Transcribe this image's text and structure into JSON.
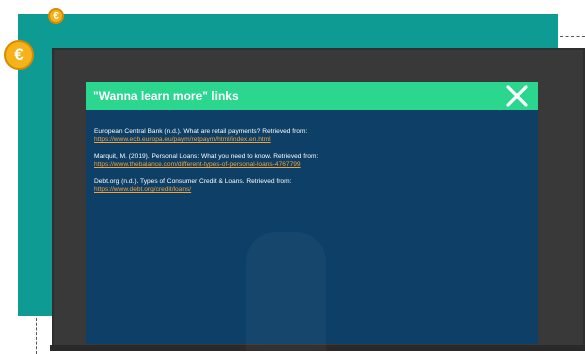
{
  "modal": {
    "title": "\"Wanna learn more\" links",
    "close_glyph": "✕",
    "references": [
      {
        "citation": "European Central Bank (n.d.). What are retail payments? Retrieved from:",
        "url": "https://www.ecb.europa.eu/paym/retpaym/html/index.en.html"
      },
      {
        "citation": "Marquit, M. (2019). Personal Loans: What you need to know. Retrieved from:",
        "url": "https://www.thebalance.com/different-types-of-personal-loans-4767799"
      },
      {
        "citation": "Debt.org (n.d.). Types of Consumer Credit & Loans. Retrieved from:",
        "url": "https://www.debt.org/credit/loans/"
      }
    ]
  },
  "decor": {
    "coin_glyph": "€"
  },
  "colors": {
    "teal_panel": "#0e9b93",
    "dark_panel": "#393939",
    "modal_bg": "#0e3f66",
    "modal_header": "#2bd68e",
    "link": "#f2a33a",
    "coin": "#f5b21a"
  },
  "icons": {
    "close": "close-icon",
    "coin": "euro-coin-icon"
  }
}
